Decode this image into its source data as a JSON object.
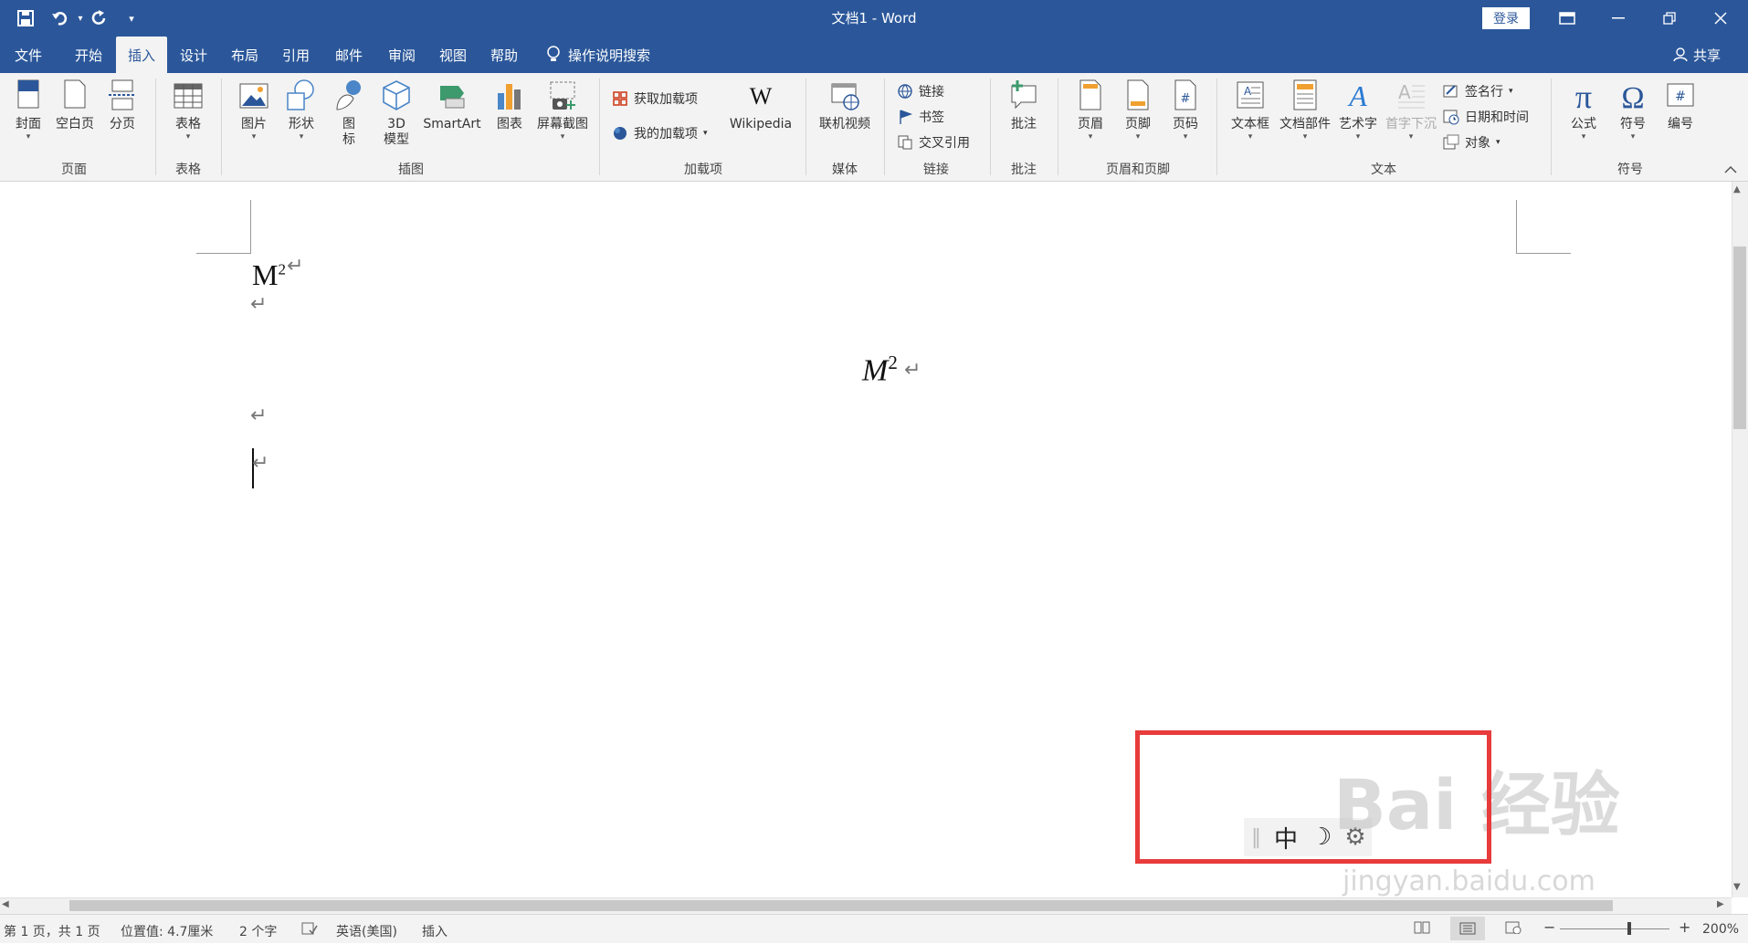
{
  "titlebar": {
    "title": "文档1 - Word",
    "login": "登录",
    "qa_icons": [
      "save-icon",
      "undo-icon",
      "redo-icon",
      "customize-qat-icon"
    ]
  },
  "tabs": [
    {
      "label": "文件"
    },
    {
      "label": "开始"
    },
    {
      "label": "插入",
      "active": true
    },
    {
      "label": "设计"
    },
    {
      "label": "布局"
    },
    {
      "label": "引用"
    },
    {
      "label": "邮件"
    },
    {
      "label": "审阅"
    },
    {
      "label": "视图"
    },
    {
      "label": "帮助"
    }
  ],
  "tell_me": "操作说明搜索",
  "share": "共享",
  "ribbon": {
    "pages": {
      "group": "页面",
      "cover": "封面",
      "blank": "空白页",
      "break": "分页"
    },
    "tables": {
      "group": "表格",
      "table": "表格"
    },
    "illustrations": {
      "group": "插图",
      "picture": "图片",
      "shapes": "形状",
      "icons_l1": "图",
      "icons_l2": "标",
      "model_l1": "3D",
      "model_l2": "模型",
      "smartart": "SmartArt",
      "chart": "图表",
      "screenshot": "屏幕截图"
    },
    "addins": {
      "group": "加载项",
      "get": "获取加载项",
      "my": "我的加载项",
      "wiki": "Wikipedia"
    },
    "media": {
      "group": "媒体",
      "video": "联机视频"
    },
    "links": {
      "group": "链接",
      "link": "链接",
      "bookmark": "书签",
      "crossref": "交叉引用"
    },
    "comments": {
      "group": "批注",
      "comment": "批注"
    },
    "headerfooter": {
      "group": "页眉和页脚",
      "header": "页眉",
      "footer": "页脚",
      "pagenum": "页码"
    },
    "text": {
      "group": "文本",
      "textbox": "文本框",
      "parts": "文档部件",
      "wordart": "艺术字",
      "dropcap": "首字下沉",
      "sigline": "签名行",
      "datetime": "日期和时间",
      "object": "对象"
    },
    "symbols": {
      "group": "符号",
      "equation": "公式",
      "symbol": "符号",
      "number": "编号"
    }
  },
  "document": {
    "line1_base": "M",
    "line1_sup": "2",
    "eq_base": "M",
    "eq_sup": "2",
    "para_mark": "↵"
  },
  "status": {
    "page": "第 1 页，共 1 页",
    "position": "位置值: 4.7厘米",
    "words": "2 个字",
    "language": "英语(美国)",
    "mode": "插入",
    "zoom": "200%"
  },
  "ime": {
    "mode": "中",
    "moon": "☽",
    "gear": "⚙"
  },
  "watermark": {
    "text": "Bai 经验",
    "url": "jingyan.baidu.com"
  }
}
